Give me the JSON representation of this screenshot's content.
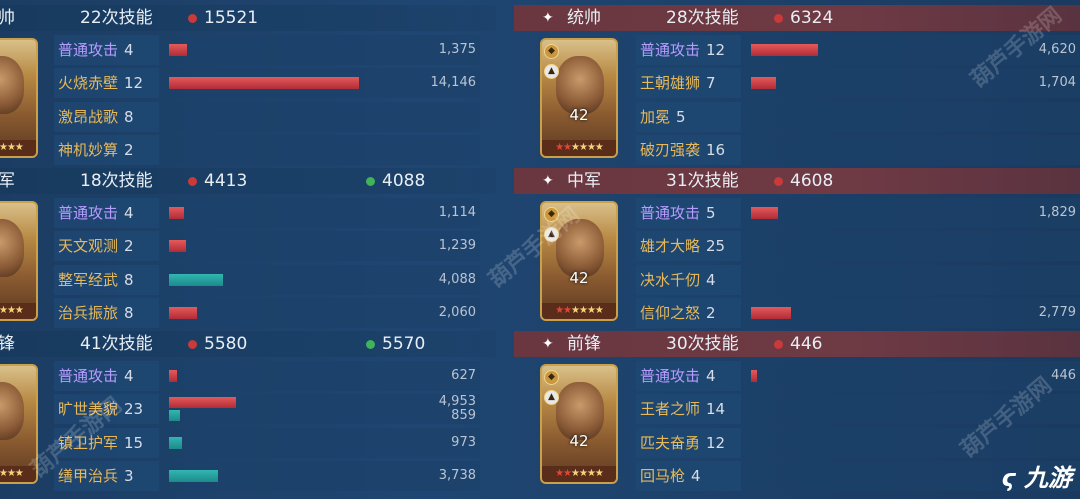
{
  "colors": {
    "red_bar": "#c83a42",
    "green_bar": "#24a0a0",
    "basic_skill": "#b79cff",
    "skill": "#e8b95a"
  },
  "left_panel": {
    "groups": [
      {
        "role": "帅",
        "skill_count": "22次技能",
        "damage": "15521",
        "heal": "",
        "rows": [
          {
            "name": "普通攻击",
            "count": "4",
            "basic": true,
            "red": 1375,
            "red_label": "1,375",
            "green": null,
            "green_label": ""
          },
          {
            "name": "火烧赤壁",
            "count": "12",
            "basic": false,
            "red": 14146,
            "red_label": "14,146",
            "green": null,
            "green_label": ""
          },
          {
            "name": "激昂战歌",
            "count": "8",
            "basic": false,
            "red": null,
            "red_label": "",
            "green": null,
            "green_label": ""
          },
          {
            "name": "神机妙算",
            "count": "2",
            "basic": false,
            "red": null,
            "red_label": "",
            "green": null,
            "green_label": ""
          }
        ]
      },
      {
        "role": "军",
        "skill_count": "18次技能",
        "damage": "4413",
        "heal": "4088",
        "rows": [
          {
            "name": "普通攻击",
            "count": "4",
            "basic": true,
            "red": 1114,
            "red_label": "1,114",
            "green": null,
            "green_label": ""
          },
          {
            "name": "天文观测",
            "count": "2",
            "basic": false,
            "red": 1239,
            "red_label": "1,239",
            "green": null,
            "green_label": ""
          },
          {
            "name": "整军经武",
            "count": "8",
            "basic": false,
            "red": null,
            "red_label": "",
            "green": 4088,
            "green_label": "4,088"
          },
          {
            "name": "治兵振旅",
            "count": "8",
            "basic": false,
            "red": 2060,
            "red_label": "2,060",
            "green": null,
            "green_label": ""
          }
        ]
      },
      {
        "role": "锋",
        "skill_count": "41次技能",
        "damage": "5580",
        "heal": "5570",
        "rows": [
          {
            "name": "普通攻击",
            "count": "4",
            "basic": true,
            "red": 627,
            "red_label": "627",
            "green": null,
            "green_label": ""
          },
          {
            "name": "旷世美貌",
            "count": "23",
            "basic": false,
            "red": 4953,
            "red_label": "4,953",
            "green": 859,
            "green_label": "859"
          },
          {
            "name": "镇卫护军",
            "count": "15",
            "basic": false,
            "red": null,
            "red_label": "",
            "green": 973,
            "green_label": "973"
          },
          {
            "name": "缮甲治兵",
            "count": "3",
            "basic": false,
            "red": null,
            "red_label": "",
            "green": 3738,
            "green_label": "3,738"
          }
        ]
      }
    ]
  },
  "right_panel": {
    "groups": [
      {
        "role": "统帅",
        "skill_count": "28次技能",
        "damage": "6324",
        "level": "42",
        "rows": [
          {
            "name": "普通攻击",
            "count": "12",
            "basic": true,
            "red": 4620,
            "red_label": "4,620",
            "green": null,
            "green_label": ""
          },
          {
            "name": "王朝雄狮",
            "count": "7",
            "basic": false,
            "red": 1704,
            "red_label": "1,704",
            "green": null,
            "green_label": ""
          },
          {
            "name": "加冕",
            "count": "5",
            "basic": false,
            "red": null,
            "red_label": "",
            "green": null,
            "green_label": ""
          },
          {
            "name": "破刃强袭",
            "count": "16",
            "basic": false,
            "red": null,
            "red_label": "",
            "green": null,
            "green_label": ""
          }
        ]
      },
      {
        "role": "中军",
        "skill_count": "31次技能",
        "damage": "4608",
        "level": "42",
        "rows": [
          {
            "name": "普通攻击",
            "count": "5",
            "basic": true,
            "red": 1829,
            "red_label": "1,829",
            "green": null,
            "green_label": ""
          },
          {
            "name": "雄才大略",
            "count": "25",
            "basic": false,
            "red": null,
            "red_label": "",
            "green": null,
            "green_label": ""
          },
          {
            "name": "决水千仞",
            "count": "4",
            "basic": false,
            "red": null,
            "red_label": "",
            "green": null,
            "green_label": ""
          },
          {
            "name": "信仰之怒",
            "count": "2",
            "basic": false,
            "red": 2779,
            "red_label": "2,779",
            "green": null,
            "green_label": ""
          }
        ]
      },
      {
        "role": "前锋",
        "skill_count": "30次技能",
        "damage": "446",
        "level": "42",
        "rows": [
          {
            "name": "普通攻击",
            "count": "4",
            "basic": true,
            "red": 446,
            "red_label": "446",
            "green": null,
            "green_label": ""
          },
          {
            "name": "王者之师",
            "count": "14",
            "basic": false,
            "red": null,
            "red_label": "",
            "green": null,
            "green_label": ""
          },
          {
            "name": "匹夫奋勇",
            "count": "12",
            "basic": false,
            "red": null,
            "red_label": "",
            "green": null,
            "green_label": ""
          },
          {
            "name": "回马枪",
            "count": "4",
            "basic": false,
            "red": null,
            "red_label": "",
            "green": null,
            "green_label": ""
          }
        ]
      }
    ]
  },
  "watermark_text": "葫芦手游网",
  "logo_text": "九游"
}
